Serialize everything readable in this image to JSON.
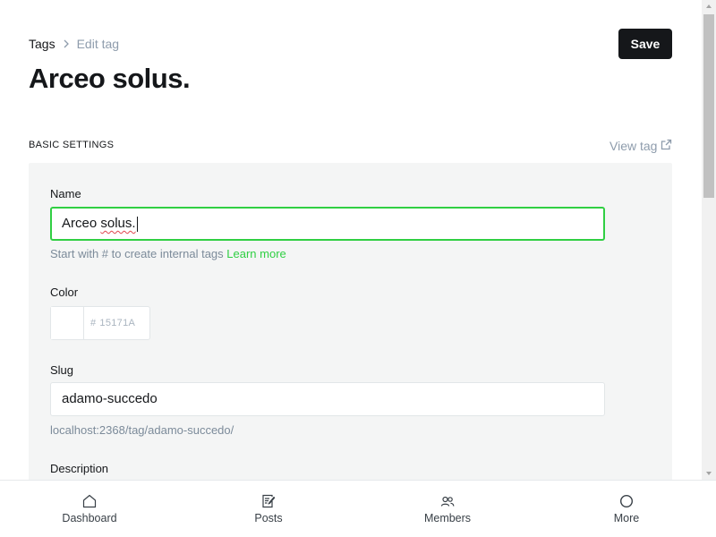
{
  "breadcrumb": {
    "parent": "Tags",
    "current": "Edit tag"
  },
  "page_title": "Arceo solus.",
  "save_label": "Save",
  "section": {
    "heading": "BASIC SETTINGS",
    "view_tag": "View tag"
  },
  "form": {
    "name_label": "Name",
    "name_value": "Arceo solus.",
    "name_value_part1": "Arceo ",
    "name_value_part2": "solus.",
    "name_hint": "Start with # to create internal tags",
    "name_hint_link": "Learn more",
    "color_label": "Color",
    "color_hash": "#",
    "color_value": "15171A",
    "slug_label": "Slug",
    "slug_value": "adamo-succedo",
    "slug_hint": "localhost:2368/tag/adamo-succedo/",
    "description_label": "Description"
  },
  "nav": [
    {
      "label": "Dashboard",
      "icon": "home-icon"
    },
    {
      "label": "Posts",
      "icon": "posts-icon"
    },
    {
      "label": "Members",
      "icon": "members-icon"
    },
    {
      "label": "More",
      "icon": "circle-icon"
    }
  ],
  "colors": {
    "accent_green": "#30cf43",
    "dark": "#15171a",
    "muted": "#8e9cac",
    "card_bg": "#f4f5f5"
  }
}
